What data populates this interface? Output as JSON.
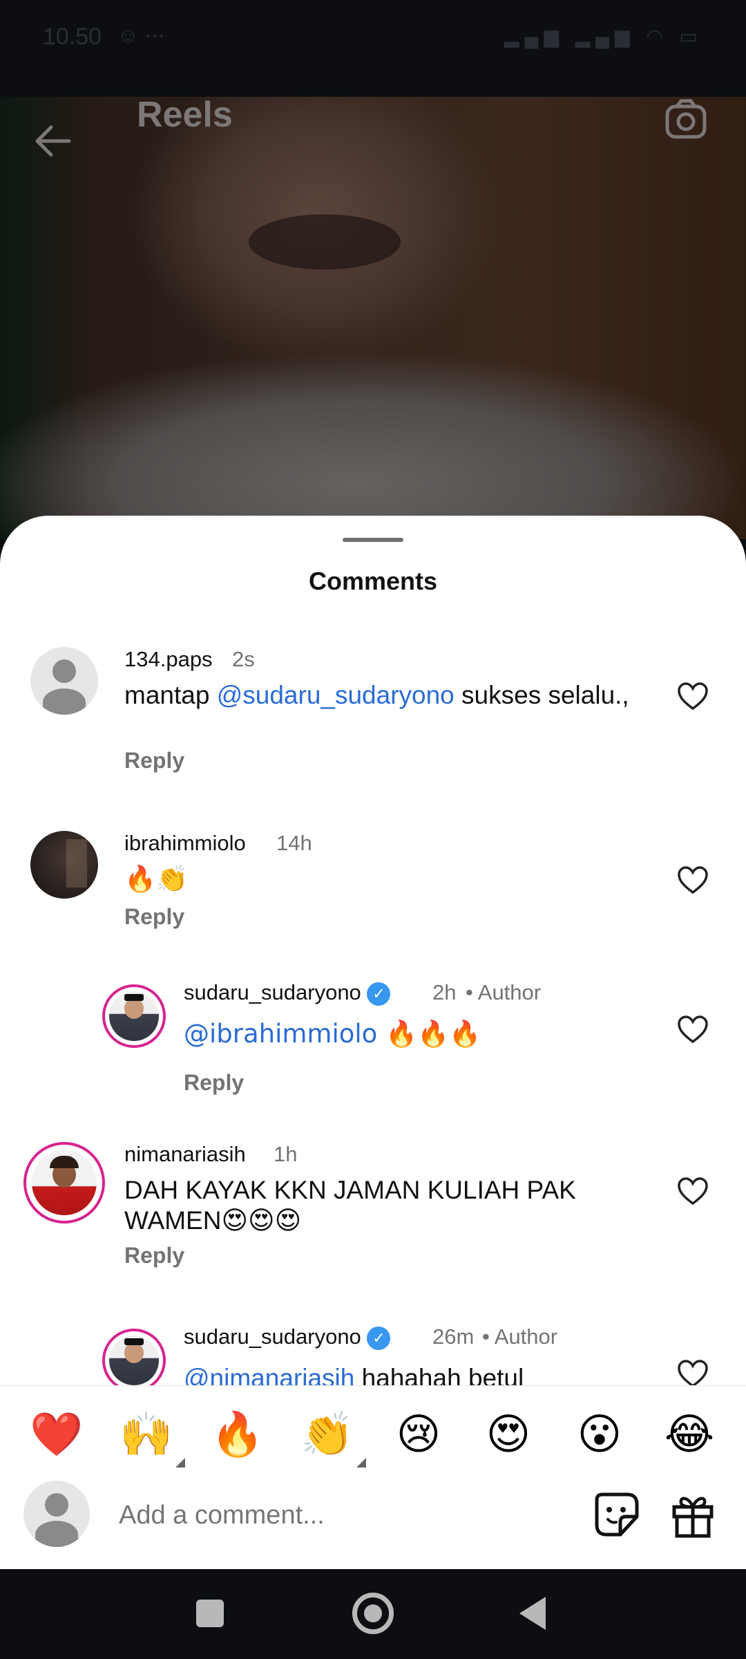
{
  "status_bar": {
    "time": "10.50",
    "battery": "30"
  },
  "header": {
    "title": "Reels",
    "back_icon": "arrow-left-icon",
    "camera_icon": "camera-icon"
  },
  "sheet": {
    "title": "Comments"
  },
  "comments": [
    {
      "username": "134.paps",
      "time": "2s",
      "text_pre": "mantap ",
      "mention": "@sudaru_sudaryono",
      "text_post": " sukses selalu.,",
      "reply": "Reply"
    },
    {
      "username": "ibrahimmiolo",
      "time": "14h",
      "text": "🔥👏",
      "reply": "Reply"
    },
    {
      "username": "sudaru_sudaryono",
      "time": "2h",
      "author": "Author",
      "mention": "@ibrahimmiolo",
      "text_post": " 🔥🔥🔥",
      "reply": "Reply"
    },
    {
      "username": "nimanariasih",
      "time": "1h",
      "text": "DAH KAYAK KKN JAMAN KULIAH PAK WAMEN😍😍😍",
      "reply": "Reply"
    },
    {
      "username": "sudaru_sudaryono",
      "time": "26m",
      "author": "Author",
      "mention": "@nimanariasih",
      "text_post": " hahahah betul"
    }
  ],
  "emoji_bar": [
    "❤️",
    "🙌",
    "🔥",
    "👏",
    "😢",
    "😍",
    "😮",
    "😂"
  ],
  "input": {
    "placeholder": "Add a comment..."
  },
  "icons": {
    "sticker": "sticker-icon",
    "gift": "gift-icon",
    "heart": "heart-outline-icon",
    "verified": "verified-badge-icon"
  },
  "colors": {
    "mention": "#2a6bd6",
    "verified": "#3897f0",
    "muted": "#737373"
  }
}
